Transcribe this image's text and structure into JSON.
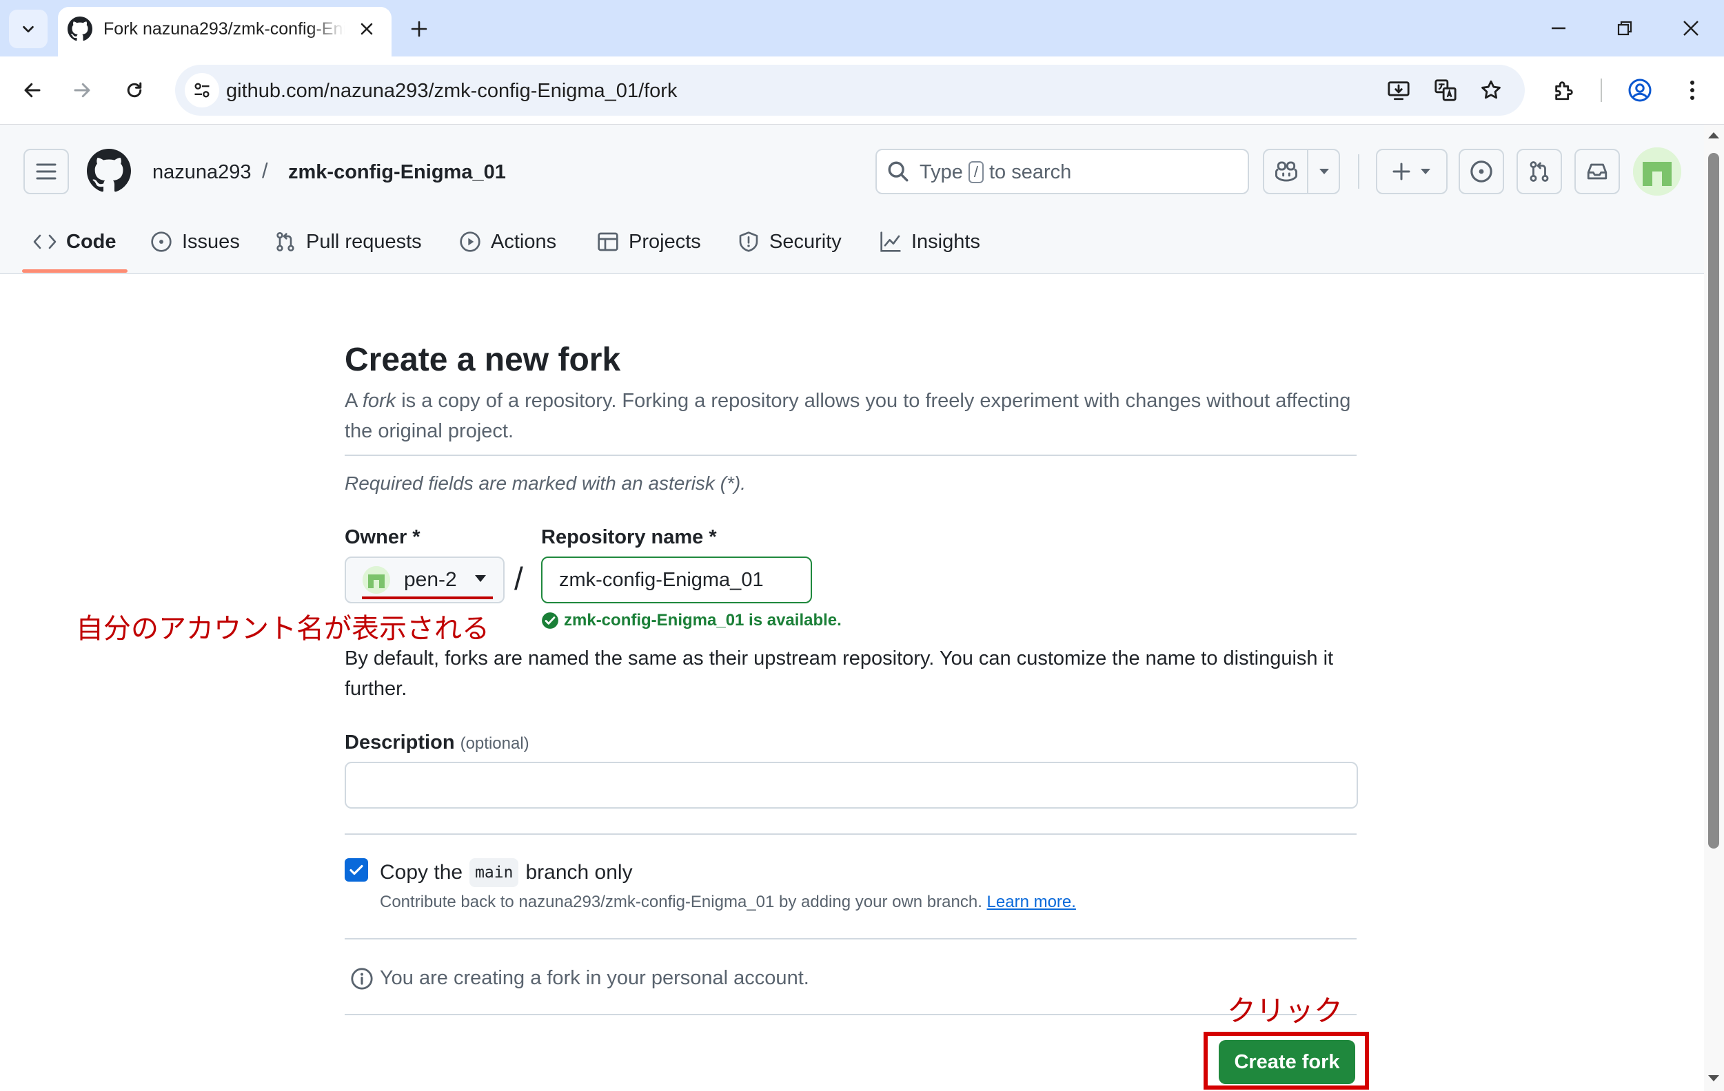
{
  "browser": {
    "tab_title": "Fork nazuna293/zmk-config-Enigma_01",
    "url": "github.com/nazuna293/zmk-config-Enigma_01/fork"
  },
  "header": {
    "owner": "nazuna293",
    "slash": "/",
    "repo": "zmk-config-Enigma_01",
    "search_prefix": "Type",
    "search_key": "/",
    "search_suffix": "to search"
  },
  "repo_nav": {
    "tabs": [
      {
        "label": "Code",
        "icon": "code-icon",
        "selected": true
      },
      {
        "label": "Issues",
        "icon": "issue-opened-icon"
      },
      {
        "label": "Pull requests",
        "icon": "git-pull-request-icon"
      },
      {
        "label": "Actions",
        "icon": "play-icon"
      },
      {
        "label": "Projects",
        "icon": "table-icon"
      },
      {
        "label": "Security",
        "icon": "shield-icon"
      },
      {
        "label": "Insights",
        "icon": "graph-icon"
      }
    ]
  },
  "form": {
    "title": "Create a new fork",
    "intro_a": "A ",
    "intro_fork": "fork",
    "intro_b": " is a copy of a repository. Forking a repository allows you to freely experiment with changes without affecting the original project.",
    "required_note": "Required fields are marked with an asterisk (*).",
    "owner_label": "Owner *",
    "owner_value": "pen-2",
    "name_separator": "/",
    "repo_label": "Repository name *",
    "repo_value": "zmk-config-Enigma_01",
    "availability": "zmk-config-Enigma_01 is available.",
    "default_note": "By default, forks are named the same as their upstream repository. You can customize the name to distinguish it further.",
    "description_label": "Description",
    "description_optional": "(optional)",
    "description_value": "",
    "copy_prefix": "Copy the",
    "copy_branch": "main",
    "copy_suffix": "branch only",
    "copy_checked": true,
    "contrib_note": "Contribute back to nazuna293/zmk-config-Enigma_01 by adding your own branch.",
    "learn_more": "Learn more.",
    "personal_note": "You are creating a fork in your personal account.",
    "create_button": "Create fork"
  },
  "annotations": {
    "account_note": "自分のアカウント名が表示される",
    "click_note": "クリック",
    "color": "#c00000"
  },
  "colors": {
    "primary_button": "#1f883d",
    "success_text": "#1a7f37",
    "link": "#0969da",
    "tab_accent": "#fd8c73"
  }
}
